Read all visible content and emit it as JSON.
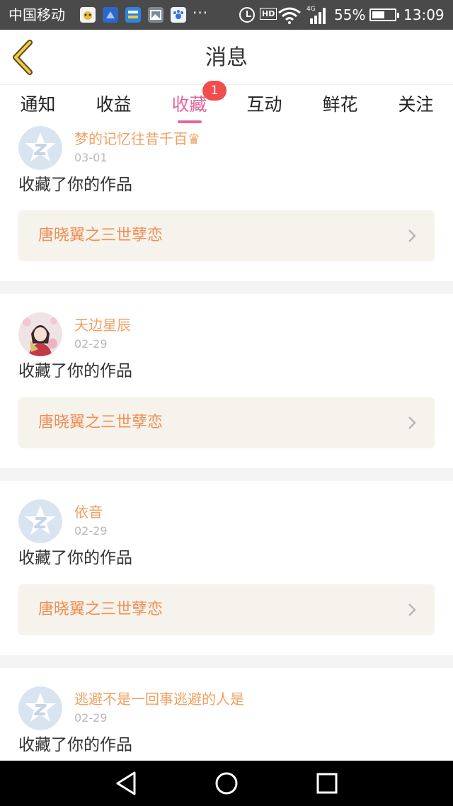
{
  "status_bar": {
    "carrier": "中国移动",
    "network": "4G",
    "hd": "HD",
    "battery_percent": "55%",
    "battery_level": 0.55,
    "time": "13:09",
    "more": "···",
    "icons": [
      "baidu-app-icon",
      "photo-app-icon",
      "news-app-icon",
      "gallery-app-icon",
      "paw-app-icon",
      "alarm-icon",
      "hd-icon",
      "wifi-icon",
      "signal-icon",
      "battery-icon"
    ]
  },
  "header": {
    "title": "消息",
    "back_icon": "chevron-left-icon"
  },
  "tabs": [
    {
      "label": "通知",
      "active": false
    },
    {
      "label": "收益",
      "active": false
    },
    {
      "label": "收藏",
      "active": true,
      "badge": "1"
    },
    {
      "label": "互动",
      "active": false
    },
    {
      "label": "鲜花",
      "active": false
    },
    {
      "label": "关注",
      "active": false
    }
  ],
  "messages": [
    {
      "user": "梦的记忆往昔千百♛",
      "date": "03-01",
      "action": "收藏了你的作品",
      "work": "唐晓翼之三世孽恋",
      "avatar": "default-star-avatar"
    },
    {
      "user": "天边星辰",
      "date": "02-29",
      "action": "收藏了你的作品",
      "work": "唐晓翼之三世孽恋",
      "avatar": "girl-photo-avatar"
    },
    {
      "user": "依音",
      "date": "02-29",
      "action": "收藏了你的作品",
      "work": "唐晓翼之三世孽恋",
      "avatar": "default-star-avatar"
    },
    {
      "user": "逃避不是一回事逃避的人是",
      "date": "02-29",
      "action": "收藏了你的作品",
      "work": "",
      "avatar": "default-star-avatar"
    }
  ],
  "nav_bar": {
    "buttons": [
      "back-triangle-icon",
      "home-circle-icon",
      "recents-square-icon"
    ]
  },
  "colors": {
    "accent": "#e8659b",
    "username": "#f0a062",
    "work_title": "#ef8f55",
    "badge": "#f14d4d",
    "status_bar": "#4a4a4a",
    "card_box": "#f5f3ec"
  }
}
